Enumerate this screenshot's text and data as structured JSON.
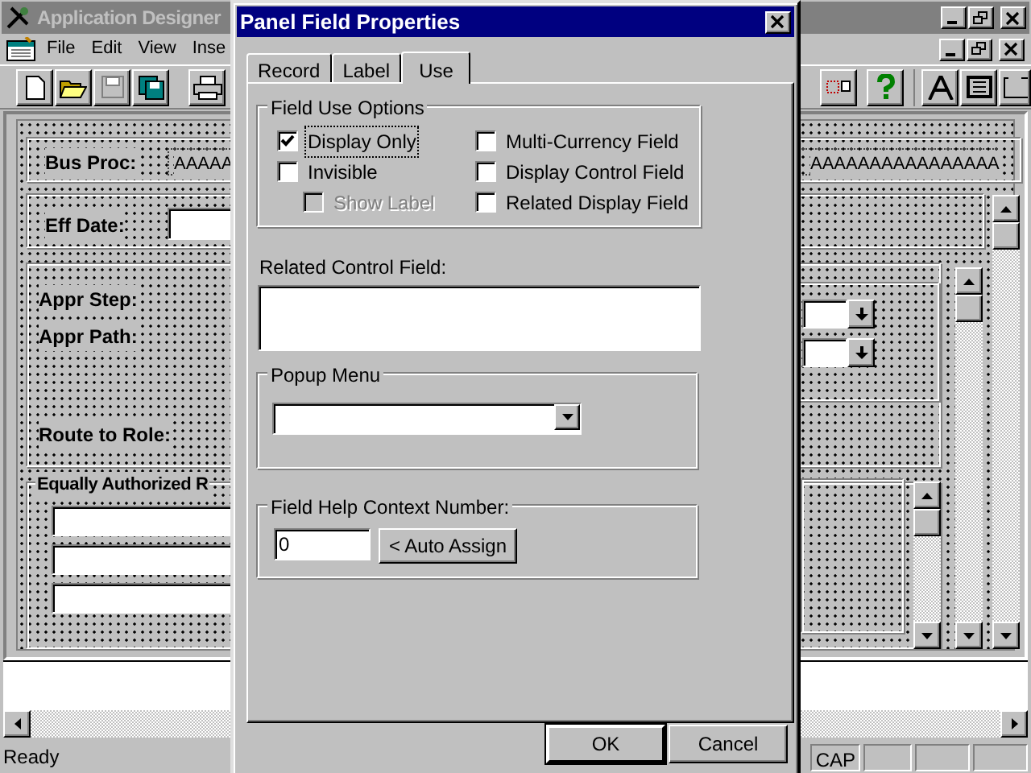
{
  "app": {
    "title": "Application Designer",
    "menu": [
      "File",
      "Edit",
      "View",
      "Inse"
    ],
    "status": "Ready",
    "indicators": [
      "CAP"
    ]
  },
  "canvas": {
    "bus_proc": {
      "label": "Bus Proc:",
      "value_left": "AAAAA",
      "value_right": "AAAAAAAAAAAAAAAA"
    },
    "eff_date": {
      "label": "Eff Date:"
    },
    "appr_labels": [
      "Appr Step:",
      "Appr Path:",
      "Route to Role:"
    ],
    "equally_authorized": {
      "title": "Equally Authorized R"
    }
  },
  "dialog": {
    "title": "Panel Field Properties",
    "tabs": [
      {
        "label": "Record",
        "selected": false
      },
      {
        "label": "Label",
        "selected": false
      },
      {
        "label": "Use",
        "selected": true
      }
    ],
    "field_use_options": {
      "title": "Field Use Options",
      "left": [
        {
          "label": "Display Only",
          "checked": true,
          "disabled": false,
          "focused": true
        },
        {
          "label": "Invisible",
          "checked": false,
          "disabled": false,
          "focused": false,
          "children": [
            {
              "label": "Show Label",
              "checked": false,
              "disabled": true,
              "focused": false
            }
          ]
        }
      ],
      "right": [
        {
          "label": "Multi-Currency Field",
          "checked": false,
          "disabled": false,
          "focused": false
        },
        {
          "label": "Display Control Field",
          "checked": false,
          "disabled": false,
          "focused": false
        },
        {
          "label": "Related Display Field",
          "checked": false,
          "disabled": false,
          "focused": false
        }
      ]
    },
    "related_control_field": {
      "label": "Related Control Field:"
    },
    "popup_menu": {
      "title": "Popup Menu"
    },
    "help_context": {
      "title": "Field Help Context Number:",
      "value": "0",
      "button": "< Auto Assign"
    },
    "buttons": [
      "OK",
      "Cancel"
    ]
  }
}
